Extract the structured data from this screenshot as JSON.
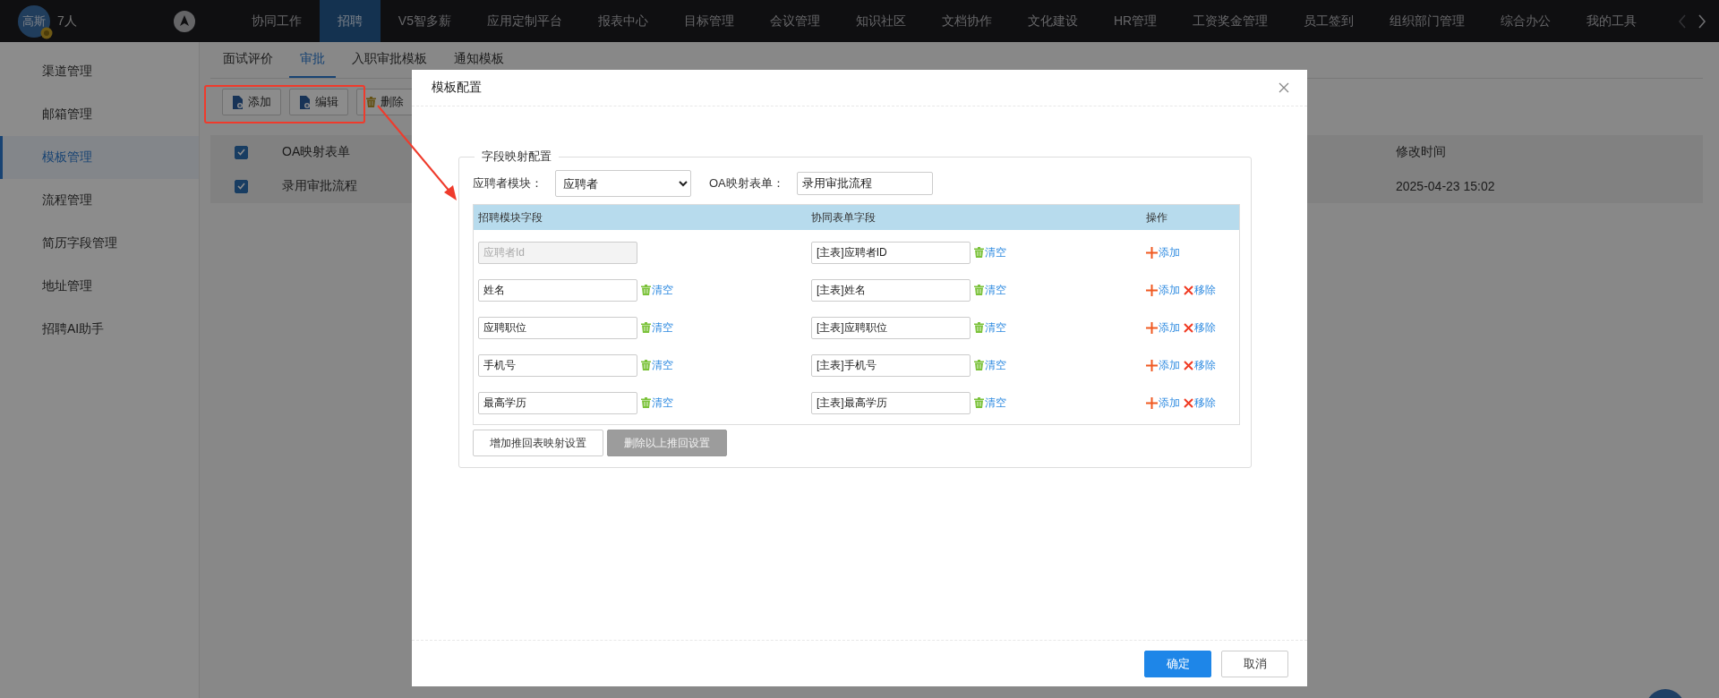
{
  "top_bar": {
    "avatar": "高斯",
    "member_count": "7人",
    "nav": [
      {
        "label": "协同工作",
        "selected": false
      },
      {
        "label": "招聘",
        "selected": true
      },
      {
        "label": "V5智多薪",
        "selected": false
      },
      {
        "label": "应用定制平台",
        "selected": false
      },
      {
        "label": "报表中心",
        "selected": false
      },
      {
        "label": "目标管理",
        "selected": false
      },
      {
        "label": "会议管理",
        "selected": false
      },
      {
        "label": "知识社区",
        "selected": false
      },
      {
        "label": "文档协作",
        "selected": false
      },
      {
        "label": "文化建设",
        "selected": false
      },
      {
        "label": "HR管理",
        "selected": false
      },
      {
        "label": "工资奖金管理",
        "selected": false
      },
      {
        "label": "员工签到",
        "selected": false
      },
      {
        "label": "组织部门管理",
        "selected": false
      },
      {
        "label": "综合办公",
        "selected": false
      },
      {
        "label": "我的工具",
        "selected": false
      }
    ],
    "arrows": [
      {
        "kind": "prev",
        "disabled": true
      },
      {
        "kind": "next",
        "disabled": false
      }
    ]
  },
  "sidebar": {
    "items": [
      {
        "label": "渠道管理",
        "selected": false
      },
      {
        "label": "邮箱管理",
        "selected": false
      },
      {
        "label": "模板管理",
        "selected": true
      },
      {
        "label": "流程管理",
        "selected": false
      },
      {
        "label": "简历字段管理",
        "selected": false
      },
      {
        "label": "地址管理",
        "selected": false
      },
      {
        "label": "招聘AI助手",
        "selected": false
      }
    ]
  },
  "tabs": [
    {
      "label": "面试评价",
      "selected": false
    },
    {
      "label": "审批",
      "selected": true
    },
    {
      "label": "入职审批模板",
      "selected": false
    },
    {
      "label": "通知模板",
      "selected": false
    }
  ],
  "toolbar": [
    {
      "kind": "add",
      "label": "添加"
    },
    {
      "kind": "edit",
      "label": "编辑"
    },
    {
      "kind": "delete",
      "label": "删除"
    }
  ],
  "table": {
    "header_checked": true,
    "columns": [
      "OA映射表单",
      "修改时间"
    ],
    "rows": [
      {
        "checked": true,
        "cells": [
          "录用审批流程",
          "2025-04-23 15:02"
        ]
      }
    ]
  },
  "dialog": {
    "title": "模板配置",
    "fieldset": {
      "legend": "字段映射配置",
      "module_label": "应聘者模块：",
      "module_value": "应聘者",
      "form_label": "OA映射表单：",
      "form_value": "录用审批流程",
      "columns": [
        "招聘模块字段",
        "协同表单字段",
        "操作"
      ],
      "rows": [
        {
          "source": {
            "value": "应聘者Id",
            "disabled": true
          },
          "target": {
            "value": "[主表]应聘者ID",
            "clear": "清空"
          },
          "actions": [
            {
              "kind": "add",
              "label": "添加"
            }
          ]
        },
        {
          "source": {
            "value": "姓名",
            "disabled": false,
            "clear": "清空"
          },
          "target": {
            "value": "[主表]姓名",
            "clear": "清空"
          },
          "actions": [
            {
              "kind": "add",
              "label": "添加"
            },
            {
              "kind": "remove",
              "label": "移除"
            }
          ]
        },
        {
          "source": {
            "value": "应聘职位",
            "disabled": false,
            "clear": "清空"
          },
          "target": {
            "value": "[主表]应聘职位",
            "clear": "清空"
          },
          "actions": [
            {
              "kind": "add",
              "label": "添加"
            },
            {
              "kind": "remove",
              "label": "移除"
            }
          ]
        },
        {
          "source": {
            "value": "手机号",
            "disabled": false,
            "clear": "清空"
          },
          "target": {
            "value": "[主表]手机号",
            "clear": "清空"
          },
          "actions": [
            {
              "kind": "add",
              "label": "添加"
            },
            {
              "kind": "remove",
              "label": "移除"
            }
          ]
        },
        {
          "source": {
            "value": "最高学历",
            "disabled": false,
            "clear": "清空"
          },
          "target": {
            "value": "[主表]最高学历",
            "clear": "清空"
          },
          "actions": [
            {
              "kind": "add",
              "label": "添加"
            },
            {
              "kind": "remove",
              "label": "移除"
            }
          ]
        }
      ],
      "buttons": [
        {
          "label": "增加推回表映射设置",
          "disabled": false
        },
        {
          "label": "删除以上推回设置",
          "disabled": true
        }
      ]
    },
    "footer": [
      {
        "label": "确定",
        "primary": true
      },
      {
        "label": "取消",
        "primary": false
      }
    ]
  }
}
